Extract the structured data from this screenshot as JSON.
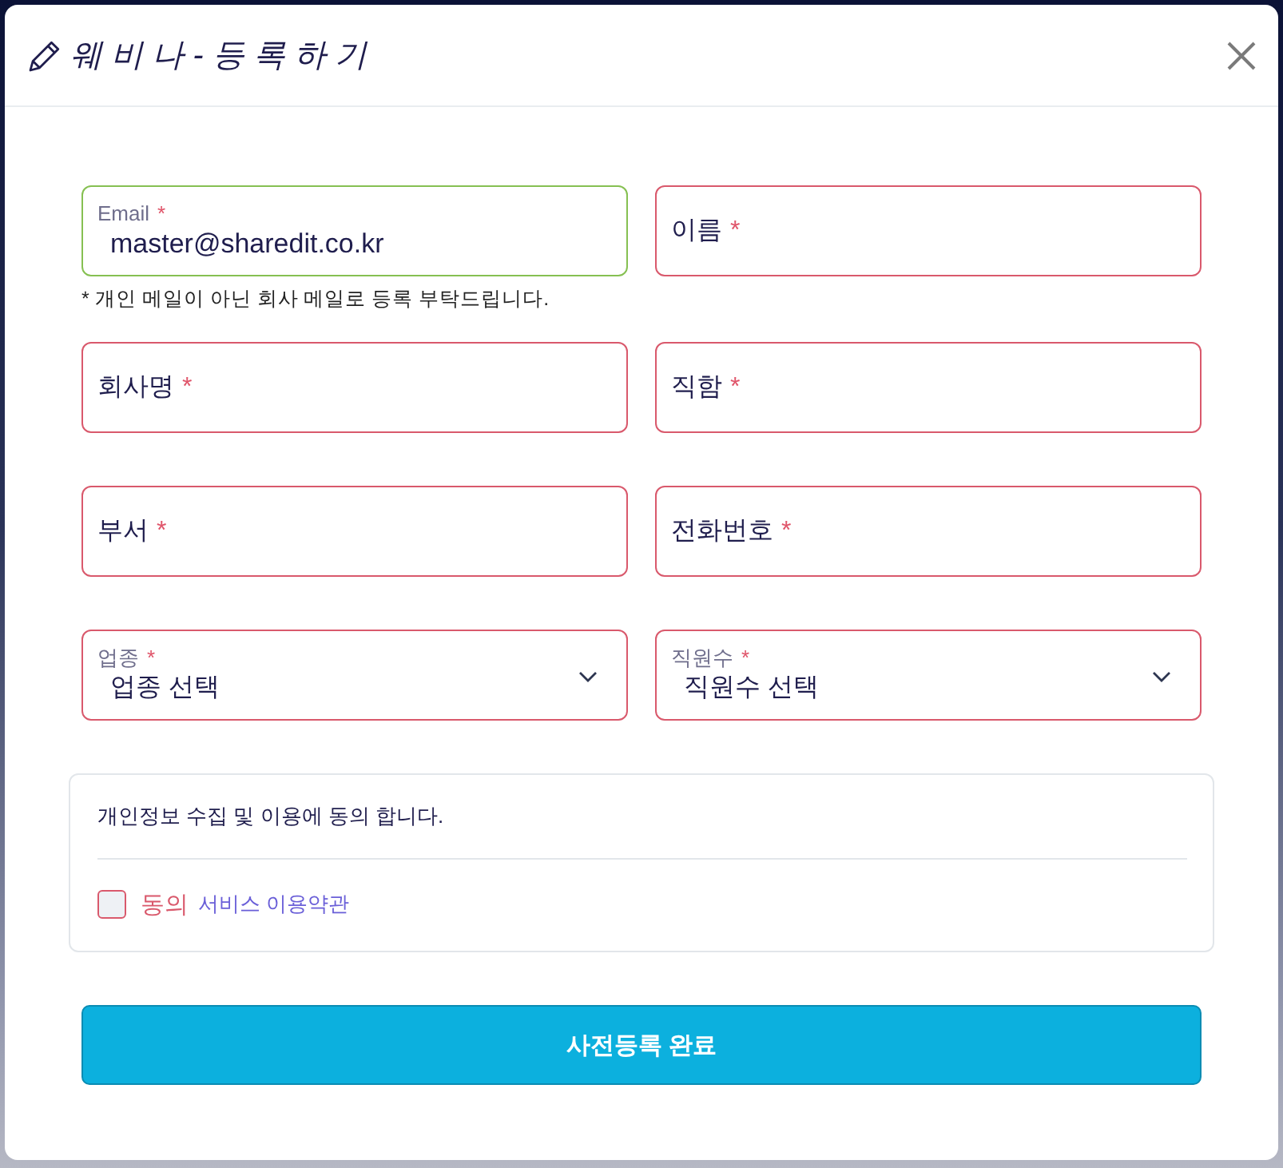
{
  "dialog": {
    "title": "웨 비 나 - 등 록 하 기"
  },
  "fields": [
    {
      "kind": "text",
      "label": "Email",
      "required_mark": "*",
      "value": "master@sharedit.co.kr",
      "valid": true,
      "hint": "* 개인 메일이 아닌 회사 메일로 등록 부탁드립니다."
    },
    {
      "kind": "text",
      "label": "이름",
      "required_mark": "*",
      "valid": false
    },
    {
      "kind": "text",
      "label": "회사명",
      "required_mark": "*",
      "valid": false
    },
    {
      "kind": "text",
      "label": "직함",
      "required_mark": "*",
      "valid": false
    },
    {
      "kind": "text",
      "label": "부서",
      "required_mark": "*",
      "valid": false
    },
    {
      "kind": "text",
      "label": "전화번호",
      "required_mark": "*",
      "valid": false
    },
    {
      "kind": "select",
      "label": "업종",
      "required_mark": "*",
      "value": "업종 선택",
      "valid": false
    },
    {
      "kind": "select",
      "label": "직원수",
      "required_mark": "*",
      "value": "직원수 선택",
      "valid": false
    }
  ],
  "consent": {
    "text": "개인정보 수집 및 이용에 동의 합니다.",
    "checkbox": {
      "label": "동의",
      "checked": false,
      "valid": false
    },
    "link": "서비스 이용약관"
  },
  "submit_button": {
    "label": "사전등록 완료"
  }
}
